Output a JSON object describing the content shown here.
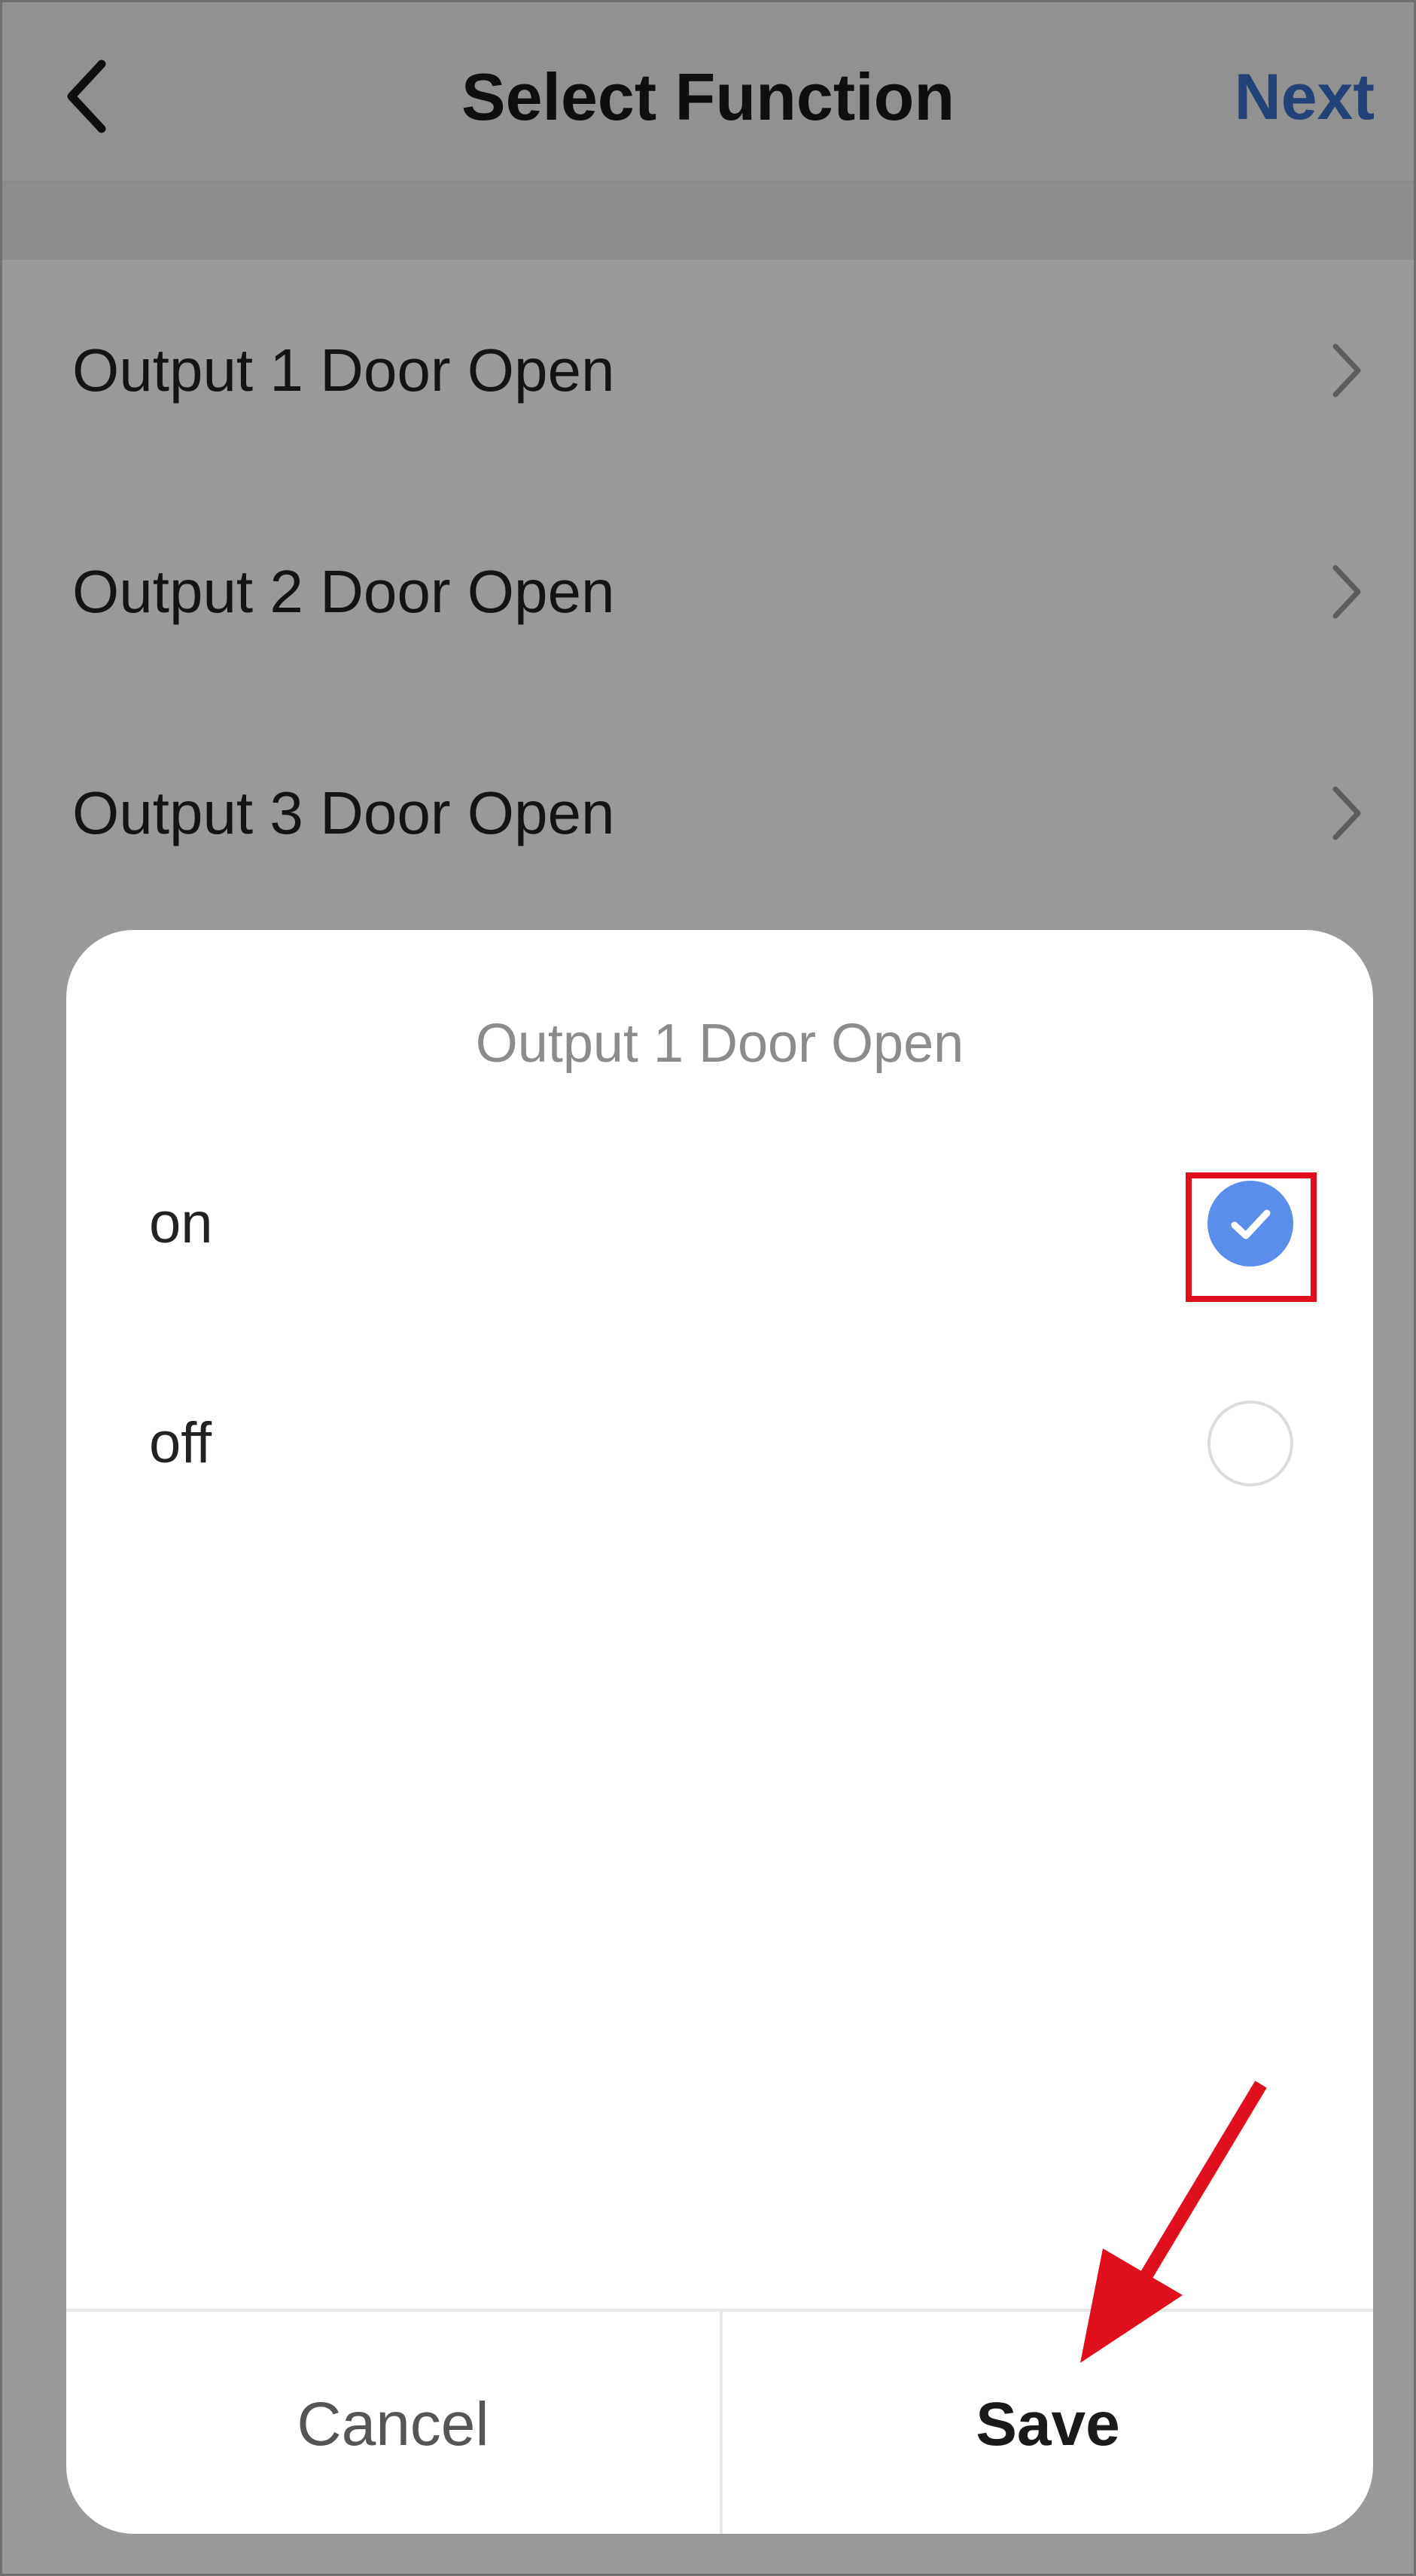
{
  "header": {
    "title": "Select Function",
    "next_label": "Next"
  },
  "list": {
    "items": [
      {
        "label": "Output 1 Door Open"
      },
      {
        "label": "Output 2 Door Open"
      },
      {
        "label": "Output 3 Door Open"
      }
    ]
  },
  "dialog": {
    "title": "Output 1 Door Open",
    "options": [
      {
        "label": "on",
        "selected": true
      },
      {
        "label": "off",
        "selected": false
      }
    ],
    "cancel_label": "Cancel",
    "save_label": "Save"
  },
  "colors": {
    "accent": "#5b8eea",
    "next_text": "#3a6ec8",
    "annotation": "#e00f1e"
  },
  "icons": [
    "chevron-left-icon",
    "chevron-right-icon",
    "checkmark-icon",
    "red-arrow-annotation",
    "red-highlight-box"
  ]
}
